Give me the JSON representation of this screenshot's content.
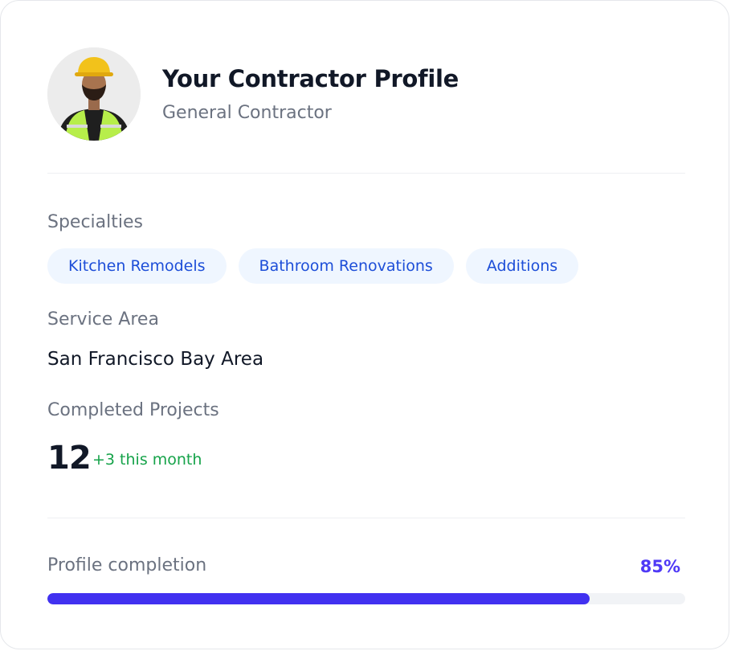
{
  "profile": {
    "title": "Your Contractor Profile",
    "role": "General Contractor",
    "avatar": "contractor-avatar-hardhat"
  },
  "specialties": {
    "label": "Specialties",
    "items": [
      "Kitchen Remodels",
      "Bathroom Renovations",
      "Additions"
    ]
  },
  "service_area": {
    "label": "Service Area",
    "value": "San Francisco Bay Area"
  },
  "projects": {
    "label": "Completed Projects",
    "count": "12",
    "delta": "+3 this month"
  },
  "completion": {
    "label": "Profile completion",
    "value_text": "85%",
    "fraction": 0.85
  },
  "colors": {
    "accent": "#4131f0",
    "chip_bg": "#eff6ff",
    "chip_text": "#1d4ed8",
    "positive": "#16a34a"
  }
}
